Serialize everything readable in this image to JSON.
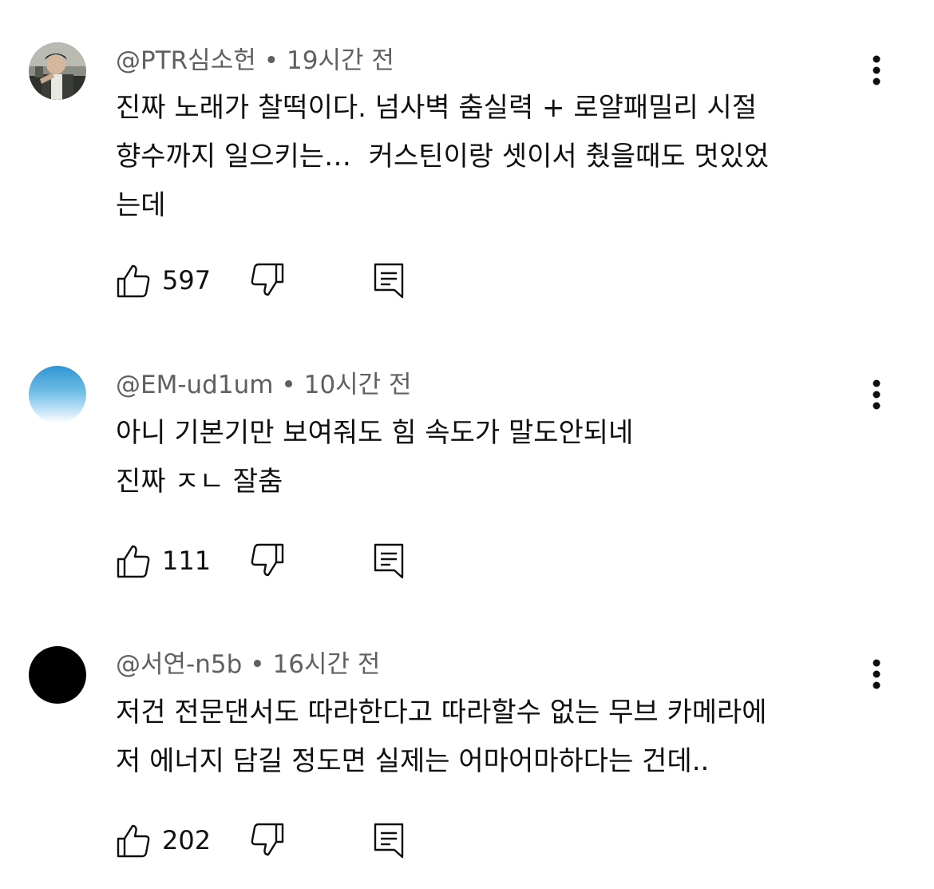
{
  "comments": [
    {
      "author": "@PTR심소헌",
      "time": "19시간 전",
      "text": "진짜 노래가 찰떡이다. 넘사벽 춤실력 + 로얄패밀리 시절\n향수까지 일으키는…  커스틴이랑 셋이서 췄을때도 멋있었\n는데",
      "likes": "597",
      "avatar": "photo"
    },
    {
      "author": "@EM-ud1um",
      "time": "10시간 전",
      "text": "아니 기본기만 보여줘도 힘 속도가 말도안되네\n진짜 ㅈㄴ 잘춤",
      "likes": "111",
      "avatar": "blue-gradient"
    },
    {
      "author": "@서연-n5b",
      "time": "16시간 전",
      "text": "저건 전문댄서도 따라한다고 따라할수 없는 무브 카메라에\n저 에너지 담길 정도면 실제는 어마어마하다는 건데..",
      "likes": "202",
      "avatar": "black"
    }
  ],
  "separator": "•",
  "icons": {
    "like": "thumbs-up-icon",
    "dislike": "thumbs-down-icon",
    "reply": "reply-icon",
    "menu": "more-vert-icon"
  },
  "colors": {
    "meta": "#606060",
    "text": "#0f0f0f",
    "avatar_blue": "#3aa0d8"
  }
}
